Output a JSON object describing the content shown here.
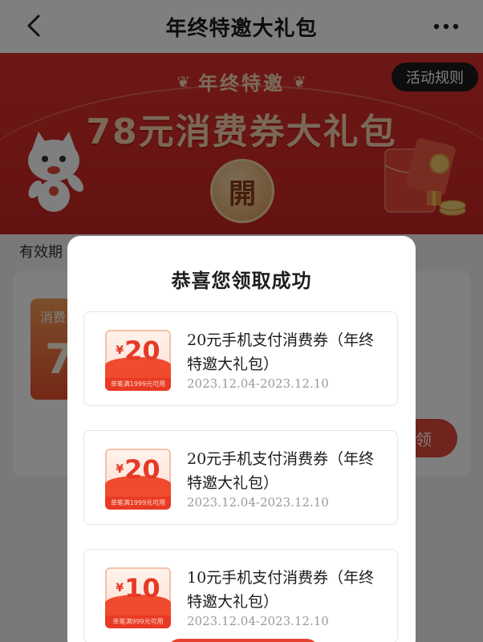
{
  "header": {
    "title": "年终特邀大礼包"
  },
  "banner": {
    "rules_label": "活动规则",
    "subtitle": "年终特邀",
    "headline": "78元消费券大礼包",
    "open_label": "開"
  },
  "background": {
    "validity_label": "有效期",
    "coupon_label": "消费",
    "coupon_amount": "7",
    "claim_label": "领"
  },
  "modal": {
    "title": "恭喜您领取成功",
    "coupons": [
      {
        "currency": "¥",
        "amount": "20",
        "condition": "单笔满1999元可用",
        "name": "20元手机支付消费券（年终特邀大礼包）",
        "date_range": "2023.12.04-2023.12.10"
      },
      {
        "currency": "¥",
        "amount": "20",
        "condition": "单笔满1999元可用",
        "name": "20元手机支付消费券（年终特邀大礼包）",
        "date_range": "2023.12.04-2023.12.10"
      },
      {
        "currency": "¥",
        "amount": "10",
        "condition": "单笔满999元可用",
        "name": "10元手机支付消费券（年终特邀大礼包）",
        "date_range": "2023.12.04-2023.12.10"
      }
    ]
  },
  "colors": {
    "banner_red": "#d9302e",
    "accent_red": "#e53a26",
    "gold": "#f7d3b0"
  }
}
